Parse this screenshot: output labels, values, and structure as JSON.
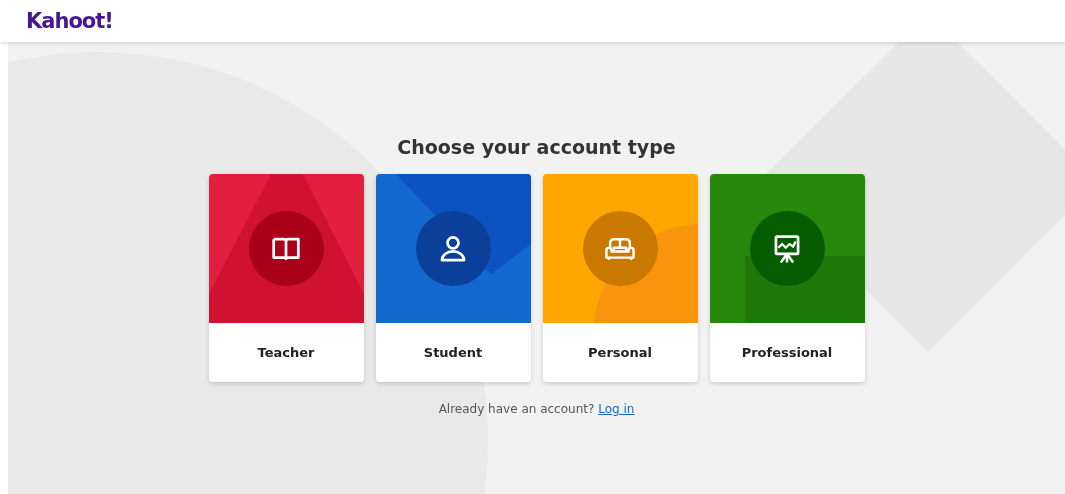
{
  "header": {
    "logo": "Kahoot!"
  },
  "title": "Choose your account type",
  "account_types": [
    {
      "kind": "teacher",
      "label": "Teacher"
    },
    {
      "kind": "student",
      "label": "Student"
    },
    {
      "kind": "personal",
      "label": "Personal"
    },
    {
      "kind": "professional",
      "label": "Professional"
    }
  ],
  "login_prompt": {
    "text": "Already have an account?",
    "link": "Log in"
  }
}
